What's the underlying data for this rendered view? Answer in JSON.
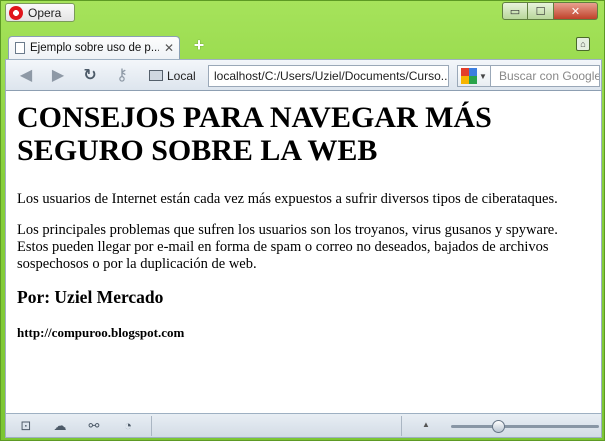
{
  "browser": {
    "menu_label": "Opera",
    "tab_title": "Ejemplo sobre uso de p...",
    "tab_close": "✕",
    "new_tab": "+",
    "security_label": "Local",
    "url": "localhost/C:/Users/Uziel/Documents/Curso...",
    "search_placeholder": "Buscar con Google",
    "window_controls": {
      "minimize": "▭",
      "maximize": "☐",
      "close": "✕"
    },
    "zoom_level": 0.3
  },
  "page": {
    "heading": "CONSEJOS PARA NAVEGAR MÁS SEGURO SOBRE LA WEB",
    "paragraph1": "Los usuarios de Internet están cada vez más expuestos a sufrir diversos tipos de ciberataques.",
    "paragraph2": "Los principales problemas que sufren los usuarios son los troyanos, virus gusanos y spyware. Estos pueden llegar por e-mail en forma de spam o correo no deseados, bajados de archivos sospechosos o por la duplicación de web.",
    "author": "Por: Uziel Mercado",
    "link": "http://compuroo.blogspot.com"
  },
  "colors": {
    "frame": "#86cf3c",
    "google": [
      "#e33e2b",
      "#3c7ee0",
      "#f6b400",
      "#2aa44b"
    ]
  }
}
